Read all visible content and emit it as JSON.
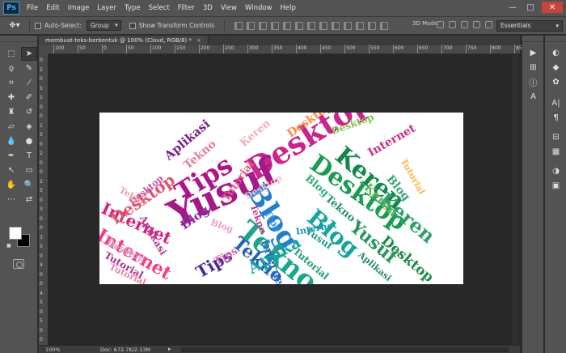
{
  "app": {
    "logo": "Ps",
    "menu": [
      "File",
      "Edit",
      "Image",
      "Layer",
      "Type",
      "Select",
      "Filter",
      "3D",
      "View",
      "Window",
      "Help"
    ],
    "window_controls": {
      "minimize": "—",
      "maximize": "□",
      "close": "✕"
    }
  },
  "options_bar": {
    "tool_icon": "move-tool-icon",
    "auto_select_label": "Auto-Select:",
    "auto_select_value": "Group",
    "transform_label": "Show Transform Controls",
    "mode3d_label": "3D Mode:",
    "workspace": "Essentials"
  },
  "document": {
    "tab_title": "membuat-teks-berbentuk @ 100% (Cloud, RGB/8) *",
    "tab_close": "×",
    "ruler_h": [
      "100",
      "50",
      "0",
      "50",
      "100",
      "150",
      "200",
      "250",
      "300",
      "350",
      "400",
      "450",
      "500",
      "550",
      "600",
      "650",
      "700",
      "750",
      "800",
      "850"
    ],
    "ruler_v": [
      "0",
      "5",
      "0",
      "5",
      "1",
      "0",
      "0",
      "1",
      "5",
      "0",
      "2",
      "0",
      "0",
      "2",
      "5",
      "0",
      "3",
      "0",
      "0",
      "3",
      "5",
      "0",
      "4",
      "0",
      "0",
      "4",
      "5",
      "0",
      "5",
      "0",
      "0"
    ],
    "status_zoom": "100%",
    "status_doc": "Doc: 672.7K/2.13M",
    "status_arrow": "▸"
  },
  "word_cloud": {
    "words": [
      {
        "text": "Desktop",
        "color": "#c9258c"
      },
      {
        "text": "Yusuf",
        "color": "#a21a86"
      },
      {
        "text": "Blog",
        "color": "#1f7ed0"
      },
      {
        "text": "Tekno",
        "color": "#1aa68c"
      },
      {
        "text": "Desktop",
        "color": "#1b9b52"
      },
      {
        "text": "Keren",
        "color": "#11884a"
      },
      {
        "text": "Tips",
        "color": "#b0148a"
      },
      {
        "text": "Internet",
        "color": "#d81f7b"
      },
      {
        "text": "Blog",
        "color": "#16a59a"
      },
      {
        "text": "Yusuf",
        "color": "#27955e"
      },
      {
        "text": "Desktop",
        "color": "#e0556f"
      },
      {
        "text": "Aplikasi",
        "color": "#7a1f8d"
      },
      {
        "text": "Tips",
        "color": "#4a2a99"
      },
      {
        "text": "Tekno",
        "color": "#2a5fb8"
      },
      {
        "text": "Internet",
        "color": "#f0408a"
      },
      {
        "text": "Keren",
        "color": "#2e9e6a"
      },
      {
        "text": "Aplika",
        "color": "#18a0a0"
      },
      {
        "text": "Tutorial",
        "color": "#e65a83"
      },
      {
        "text": "Blog",
        "color": "#8b2c9c"
      },
      {
        "text": "Desktop",
        "color": "#1e8b4a"
      },
      {
        "text": "Tekno",
        "color": "#28906e"
      },
      {
        "text": "Tutorial",
        "color": "#a8338f"
      },
      {
        "text": "Internet",
        "color": "#2b6fc3"
      },
      {
        "text": "Keren",
        "color": "#f0b0b8"
      },
      {
        "text": "Blog",
        "color": "#3ca27a"
      },
      {
        "text": "Desktop",
        "color": "#e0a0c0"
      },
      {
        "text": "Tips",
        "color": "#3a8fd8"
      },
      {
        "text": "Aplikasi",
        "color": "#b43a8e"
      },
      {
        "text": "Tekno",
        "color": "#e27b9c"
      },
      {
        "text": "Internet",
        "color": "#d02d84"
      },
      {
        "text": "Desktop",
        "color": "#c54fa3"
      },
      {
        "text": "Tutorial",
        "color": "#1f9a7a"
      },
      {
        "text": "Blog",
        "color": "#33b07a"
      },
      {
        "text": "Keren",
        "color": "#5cb85c"
      },
      {
        "text": "Yusuf",
        "color": "#1e9e86"
      },
      {
        "text": "Tips",
        "color": "#e36aa8"
      },
      {
        "text": "Tekno",
        "color": "#f2a0a0"
      },
      {
        "text": "Internet",
        "color": "#2196b0"
      },
      {
        "text": "Desktop",
        "color": "#f7c0d0"
      },
      {
        "text": "Blog",
        "color": "#e8a0c8"
      },
      {
        "text": "Tutorial",
        "color": "#ea7fa0"
      },
      {
        "text": "Aplikasi",
        "color": "#1f8e6a"
      },
      {
        "text": "Tekno",
        "color": "#c03c8a"
      },
      {
        "text": "Desktop",
        "color": "#ff8a4a"
      },
      {
        "text": "Desktop",
        "color": "#8bc34a"
      },
      {
        "text": "Tutorial",
        "color": "#ffb74d"
      }
    ]
  }
}
